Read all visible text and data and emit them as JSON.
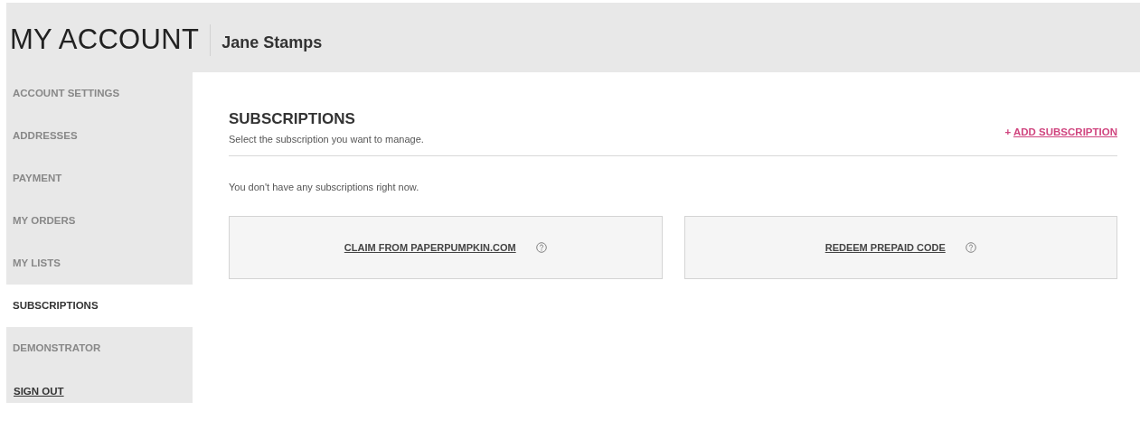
{
  "header": {
    "title": "MY ACCOUNT",
    "user_name": "Jane Stamps"
  },
  "sidebar": {
    "items": [
      {
        "label": "ACCOUNT SETTINGS",
        "selected": false
      },
      {
        "label": "ADDRESSES",
        "selected": false
      },
      {
        "label": "PAYMENT",
        "selected": false
      },
      {
        "label": "MY ORDERS",
        "selected": false
      },
      {
        "label": "MY LISTS",
        "selected": false
      },
      {
        "label": "SUBSCRIPTIONS",
        "selected": true
      },
      {
        "label": "DEMONSTRATOR",
        "selected": false
      }
    ],
    "sign_out": "SIGN OUT"
  },
  "main": {
    "title": "SUBSCRIPTIONS",
    "subtitle": "Select the subscription you want to manage.",
    "add_link": {
      "symbol": "+",
      "label": "ADD SUBSCRIPTION"
    },
    "empty_message": "You don't have any subscriptions right now.",
    "options": [
      {
        "label": "CLAIM FROM PAPERPUMPKIN.COM"
      },
      {
        "label": "REDEEM PREPAID CODE"
      }
    ]
  }
}
